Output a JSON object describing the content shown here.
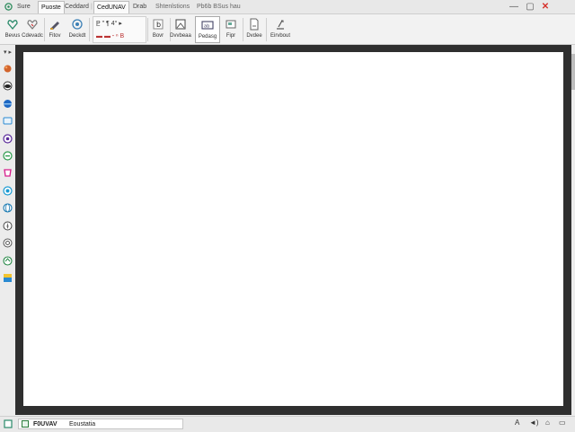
{
  "titlebar": {
    "tabs": [
      {
        "label": "Sure"
      },
      {
        "label": "Puoste"
      },
      {
        "label": "Ceddard"
      },
      {
        "label": "CedUNAV"
      },
      {
        "label": "Drab"
      },
      {
        "label": "Shtenlstions"
      },
      {
        "label": "Pb6b BSus hau"
      }
    ],
    "minimize": "—",
    "maximize": "▢",
    "close": "✕"
  },
  "ribbon": {
    "tools": [
      {
        "label": "Bevus"
      },
      {
        "label": "Cdevadc"
      },
      {
        "label": "Fitov"
      },
      {
        "label": "Deckdt"
      },
      {
        "label": "Bovr"
      },
      {
        "label": "Dvvbeaa"
      },
      {
        "label": "Pedasg"
      },
      {
        "label": "Fipr"
      },
      {
        "label": "Dvdee"
      },
      {
        "label": "Eirvbout"
      }
    ],
    "group_top_text": "P̲ \"   ¶ 4°   ▸",
    "group_bottom_text": "▬ ▬  ꞏ  ⁿ  B"
  },
  "statusbar": {
    "field_label": "F0UVAV",
    "field_value": "Eoustatia",
    "right_icons": [
      "text-a-icon",
      "volume-icon",
      "network-icon"
    ]
  },
  "colors": {
    "canvas": "#ffffff",
    "frame": "#2f2f2f",
    "accent_close": "#d6312b"
  }
}
